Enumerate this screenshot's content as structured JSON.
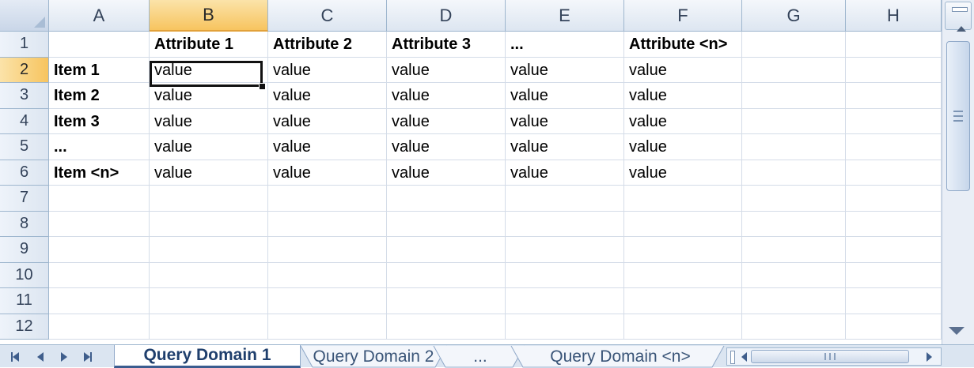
{
  "spreadsheet": {
    "columns": [
      "A",
      "B",
      "C",
      "D",
      "E",
      "F",
      "G",
      "H"
    ],
    "active_column": "B",
    "active_row": "2",
    "row_numbers": [
      "1",
      "2",
      "3",
      "4",
      "5",
      "6",
      "7",
      "8",
      "9",
      "10",
      "11",
      "12"
    ],
    "rows": [
      [
        "",
        "Attribute 1",
        "Attribute 2",
        "Attribute 3",
        "...",
        "Attribute <n>",
        "",
        ""
      ],
      [
        "Item 1",
        "value",
        "value",
        "value",
        "value",
        "value",
        "",
        ""
      ],
      [
        "Item 2",
        "value",
        "value",
        "value",
        "value",
        "value",
        "",
        ""
      ],
      [
        "Item 3",
        "value",
        "value",
        "value",
        "value",
        "value",
        "",
        ""
      ],
      [
        "...",
        "value",
        "value",
        "value",
        "value",
        "value",
        "",
        ""
      ],
      [
        "Item <n>",
        "value",
        "value",
        "value",
        "value",
        "value",
        "",
        ""
      ],
      [
        "",
        "",
        "",
        "",
        "",
        "",
        "",
        ""
      ],
      [
        "",
        "",
        "",
        "",
        "",
        "",
        "",
        ""
      ],
      [
        "",
        "",
        "",
        "",
        "",
        "",
        "",
        ""
      ],
      [
        "",
        "",
        "",
        "",
        "",
        "",
        "",
        ""
      ],
      [
        "",
        "",
        "",
        "",
        "",
        "",
        "",
        ""
      ],
      [
        "",
        "",
        "",
        "",
        "",
        "",
        "",
        ""
      ]
    ]
  },
  "sheet_tabs": {
    "tabs": [
      "Query Domain 1",
      "Query Domain 2",
      "...",
      "Query Domain <n>"
    ],
    "active_tab": "Query Domain 1"
  },
  "icons": {
    "nav_first": "first-sheet-icon",
    "nav_prev": "previous-sheet-icon",
    "nav_next": "next-sheet-icon",
    "nav_last": "last-sheet-icon"
  },
  "colors": {
    "header_bg": "#dde6f1",
    "active_header": "#f7c45f",
    "grid_line": "#d4dce8",
    "selection_border": "#111111"
  }
}
